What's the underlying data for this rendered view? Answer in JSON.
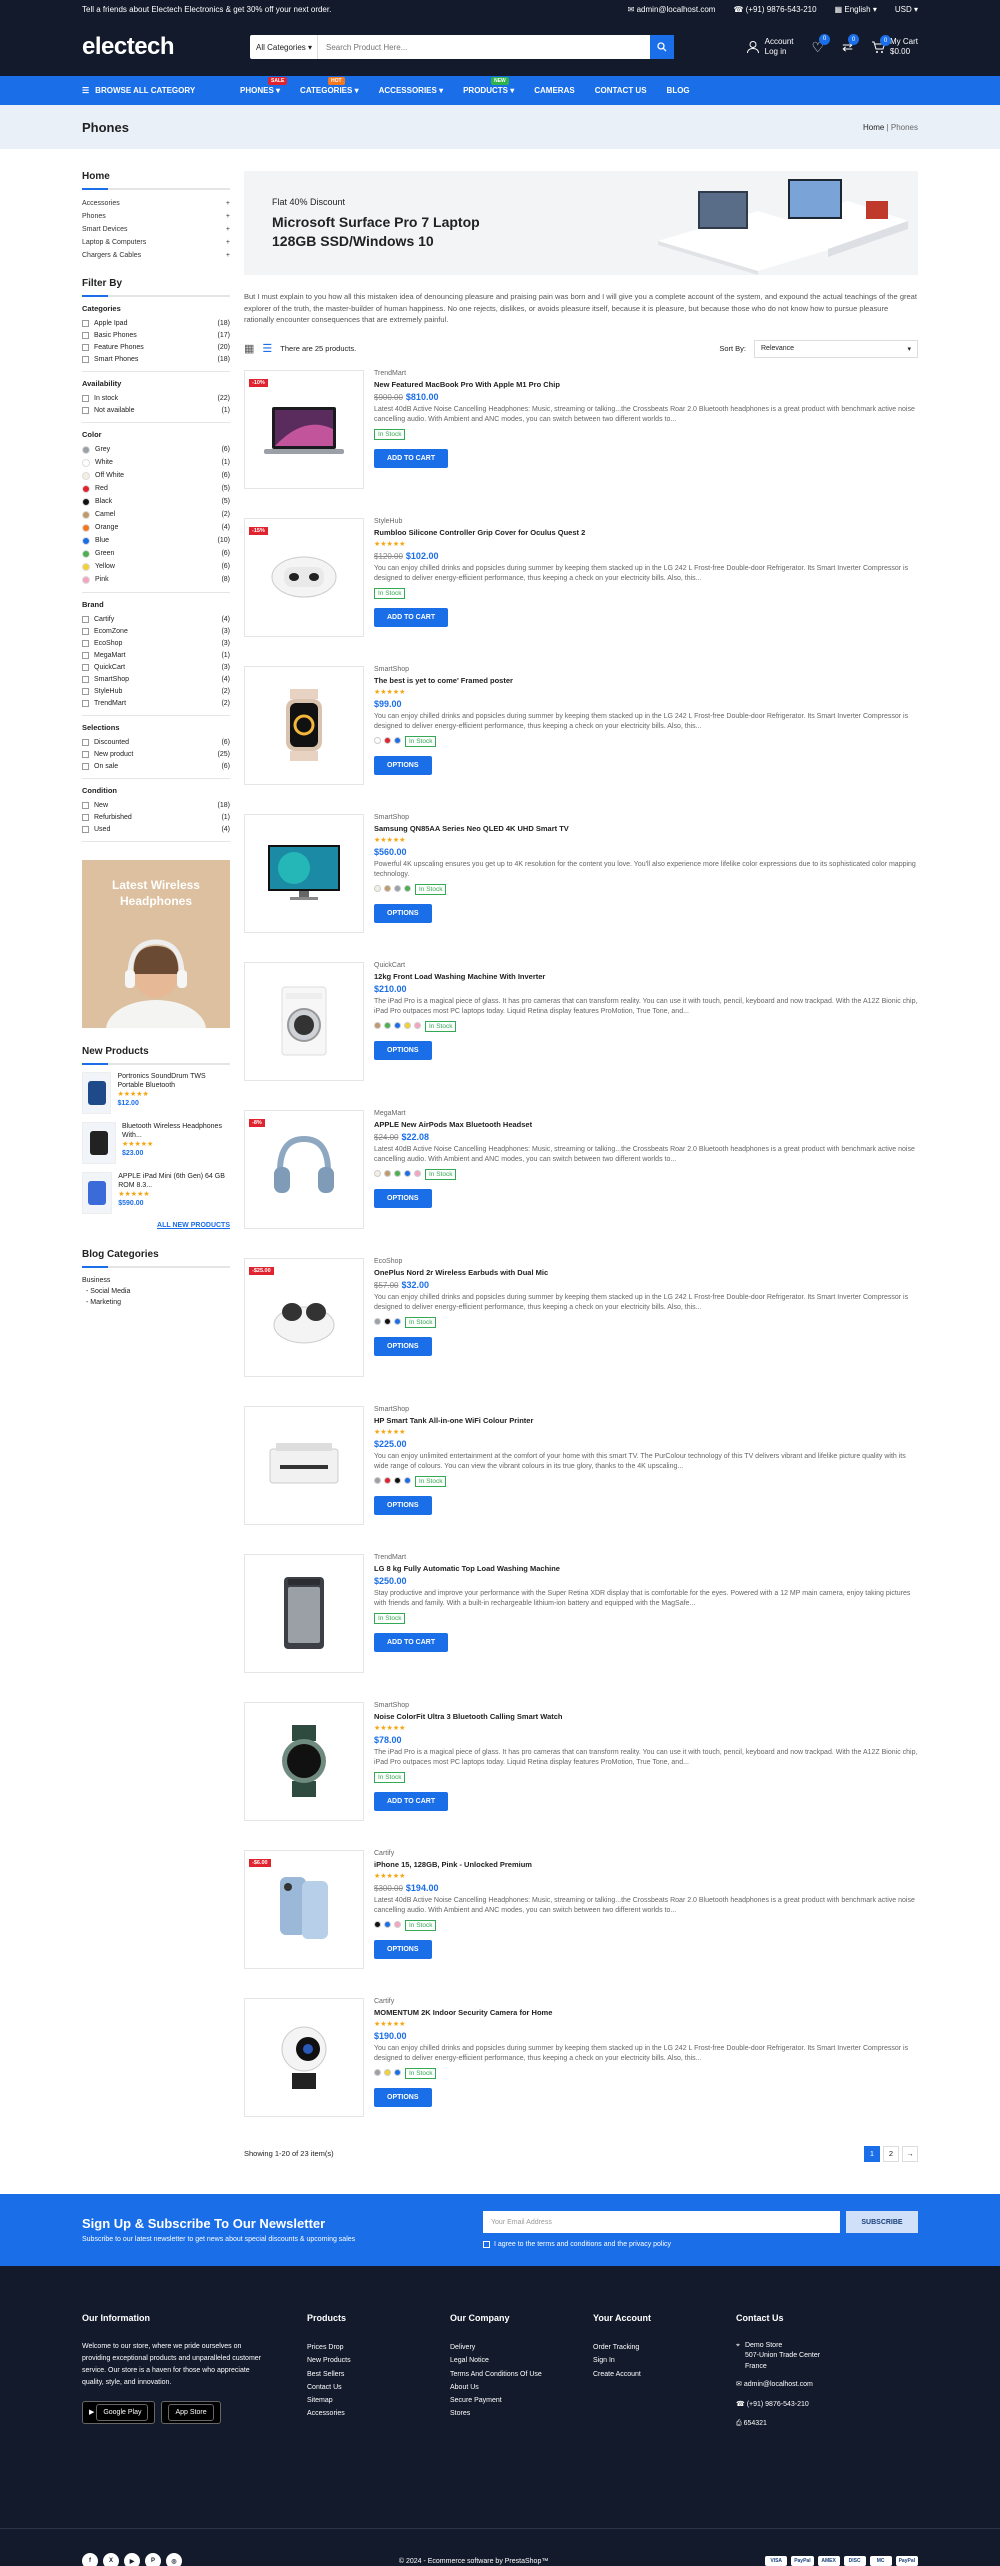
{
  "topbar": {
    "promo": "Tell a friends about Electech Electronics & get 30% off your next order.",
    "email": "admin@localhost.com",
    "phone": "(+91) 9876-543-210",
    "language": "English",
    "currency": "USD"
  },
  "header": {
    "logo": "electech",
    "search_category": "All Categories",
    "search_placeholder": "Search Product Here...",
    "account_label": "Account",
    "login_label": "Log in",
    "wishlist_count": "0",
    "compare_count": "0",
    "cart_count": "0",
    "cart_label": "My Cart",
    "cart_total": "$0.00"
  },
  "nav": {
    "browse": "BROWSE ALL CATEGORY",
    "items": [
      {
        "label": "PHONES",
        "tag": "SALE",
        "tag_color": "#e0232e"
      },
      {
        "label": "CATEGORIES",
        "tag": "HOT",
        "tag_color": "#f5781f"
      },
      {
        "label": "ACCESSORIES",
        "tag": "",
        "tag_color": ""
      },
      {
        "label": "PRODUCTS",
        "tag": "NEW",
        "tag_color": "#2db34a"
      },
      {
        "label": "CAMERAS",
        "tag": "",
        "tag_color": ""
      },
      {
        "label": "CONTACT US",
        "tag": "",
        "tag_color": ""
      },
      {
        "label": "BLOG",
        "tag": "",
        "tag_color": ""
      }
    ]
  },
  "page": {
    "title": "Phones",
    "crumb_home": "Home",
    "crumb_current": "Phones"
  },
  "sidebar": {
    "home": "Home",
    "categories": [
      "Accessories",
      "Phones",
      "Smart Devices",
      "Laptop & Computers",
      "Chargers & Cables"
    ],
    "filter_title": "Filter By",
    "groups": [
      {
        "title": "Categories",
        "rows": [
          {
            "label": "Apple Ipad",
            "count": "(18)"
          },
          {
            "label": "Basic Phones",
            "count": "(17)"
          },
          {
            "label": "Feature Phones",
            "count": "(20)"
          },
          {
            "label": "Smart Phones",
            "count": "(18)"
          }
        ]
      },
      {
        "title": "Availability",
        "rows": [
          {
            "label": "In stock",
            "count": "(22)"
          },
          {
            "label": "Not available",
            "count": "(1)"
          }
        ]
      },
      {
        "title": "Color",
        "rows": [
          {
            "label": "Grey",
            "count": "(6)",
            "color": "#9aa0a6"
          },
          {
            "label": "White",
            "count": "(1)",
            "color": "#ffffff"
          },
          {
            "label": "Off White",
            "count": "(6)",
            "color": "#f4efe3"
          },
          {
            "label": "Red",
            "count": "(5)",
            "color": "#e0232e"
          },
          {
            "label": "Black",
            "count": "(5)",
            "color": "#111111"
          },
          {
            "label": "Camel",
            "count": "(2)",
            "color": "#c19a6b"
          },
          {
            "label": "Orange",
            "count": "(4)",
            "color": "#f5781f"
          },
          {
            "label": "Blue",
            "count": "(10)",
            "color": "#1a6ee8"
          },
          {
            "label": "Green",
            "count": "(6)",
            "color": "#4caf50"
          },
          {
            "label": "Yellow",
            "count": "(6)",
            "color": "#f2d233"
          },
          {
            "label": "Pink",
            "count": "(8)",
            "color": "#f4a6c0"
          }
        ]
      },
      {
        "title": "Brand",
        "rows": [
          {
            "label": "Cartify",
            "count": "(4)"
          },
          {
            "label": "EcomZone",
            "count": "(3)"
          },
          {
            "label": "EcoShop",
            "count": "(3)"
          },
          {
            "label": "MegaMart",
            "count": "(1)"
          },
          {
            "label": "QuickCart",
            "count": "(3)"
          },
          {
            "label": "SmartShop",
            "count": "(4)"
          },
          {
            "label": "StyleHub",
            "count": "(2)"
          },
          {
            "label": "TrendMart",
            "count": "(2)"
          }
        ]
      },
      {
        "title": "Selections",
        "rows": [
          {
            "label": "Discounted",
            "count": "(6)"
          },
          {
            "label": "New product",
            "count": "(25)"
          },
          {
            "label": "On sale",
            "count": "(6)"
          }
        ]
      },
      {
        "title": "Condition",
        "rows": [
          {
            "label": "New",
            "count": "(18)"
          },
          {
            "label": "Refurbished",
            "count": "(1)"
          },
          {
            "label": "Used",
            "count": "(4)"
          }
        ]
      }
    ],
    "banner": "Latest Wireless Headphones",
    "new_title": "New Products",
    "new_products": [
      {
        "name": "Portronics SoundDrum TWS Portable Bluetooth",
        "price": "$12.00"
      },
      {
        "name": "Bluetooth Wireless Headphones With...",
        "price": "$23.00"
      },
      {
        "name": "APPLE iPad Mini (6th Gen) 64 GB ROM 8.3...",
        "price": "$590.00"
      }
    ],
    "all_new": "ALL NEW PRODUCTS",
    "blog_title": "Blog Categories",
    "blog": [
      "Business",
      "- Social Media",
      "- Marketing"
    ]
  },
  "hero": {
    "sub": "Flat 40% Discount",
    "title1": "Microsoft Surface Pro 7 Laptop",
    "title2": "128GB SSD/Windows 10"
  },
  "description": "But I must explain to you how all this mistaken idea of denouncing pleasure and praising pain was born and I will give you a complete account of the system, and expound the actual teachings of the great explorer of the truth, the master-builder of human happiness. No one rejects, dislikes, or avoids pleasure itself, because it is pleasure, but because those who do not know how to pursue pleasure rationally encounter consequences that are extremely painful.",
  "toolbar": {
    "count": "There are 25 products.",
    "sort_label": "Sort By:",
    "sort_value": "Relevance"
  },
  "products": [
    {
      "brand": "TrendMart",
      "name": "New Featured MacBook Pro With Apple M1 Pro Chip",
      "old": "$900.00",
      "price": "$810.00",
      "disc": "-10%",
      "desc": "Latest 40dB Active Noise Cancelling Headphones: Music, streaming or talking...the Crossbeats Roar 2.0 Bluetooth headphones is a great product with benchmark active noise cancelling audio. With Ambient and ANC modes, you can switch between two different worlds to...",
      "btn": "ADD TO CART",
      "stock": "In Stock",
      "rated": false,
      "swatches": []
    },
    {
      "brand": "StyleHub",
      "name": "Rumbloo Silicone Controller Grip Cover for Oculus Quest 2",
      "old": "$120.00",
      "price": "$102.00",
      "disc": "-15%",
      "desc": "You can enjoy chilled drinks and popsicles during summer by keeping them stacked up in the LG 242 L Frost-free Double-door Refrigerator. Its Smart Inverter Compressor is designed to deliver energy-efficient performance, thus keeping a check on your electricity bills. Also, this...",
      "btn": "ADD TO CART",
      "stock": "In Stock",
      "rated": true,
      "swatches": []
    },
    {
      "brand": "SmartShop",
      "name": "The best is yet to come' Framed poster",
      "old": "",
      "price": "$99.00",
      "disc": "",
      "desc": "You can enjoy chilled drinks and popsicles during summer by keeping them stacked up in the LG 242 L Frost-free Double-door Refrigerator. Its Smart Inverter Compressor is designed to deliver energy-efficient performance, thus keeping a check on your electricity bills. Also, this...",
      "btn": "OPTIONS",
      "stock": "In Stock",
      "rated": true,
      "swatches": [
        "#ffffff",
        "#e0232e",
        "#1a6ee8"
      ]
    },
    {
      "brand": "SmartShop",
      "name": "Samsung QN85AA Series Neo QLED 4K UHD Smart TV",
      "old": "",
      "price": "$560.00",
      "disc": "",
      "desc": "Powerful 4K upscaling ensures you get up to 4K resolution for the content you love. You'll also experience more lifelike color expressions due to its sophisticated color mapping technology.",
      "btn": "OPTIONS",
      "stock": "In Stock",
      "rated": true,
      "swatches": [
        "#f4efe3",
        "#c19a6b",
        "#9aa0a6",
        "#4caf50"
      ]
    },
    {
      "brand": "QuickCart",
      "name": "12kg Front Load Washing Machine With Inverter",
      "old": "",
      "price": "$210.00",
      "disc": "",
      "desc": "The iPad Pro is a magical piece of glass. It has pro cameras that can transform reality. You can use it with touch, pencil, keyboard and now trackpad. With the A12Z Bionic chip, iPad Pro outpaces most PC laptops today. Liquid Retina display features ProMotion, True Tone, and...",
      "btn": "OPTIONS",
      "stock": "In Stock",
      "rated": false,
      "swatches": [
        "#c19a6b",
        "#4caf50",
        "#1a6ee8",
        "#f2d233",
        "#f4a6c0"
      ]
    },
    {
      "brand": "MegaMart",
      "name": "APPLE New AirPods Max Bluetooth Headset",
      "old": "$24.00",
      "price": "$22.08",
      "disc": "-8%",
      "desc": "Latest 40dB Active Noise Cancelling Headphones: Music, streaming or talking...the Crossbeats Roar 2.0 Bluetooth headphones is a great product with benchmark active noise cancelling audio. With Ambient and ANC modes, you can switch between two different worlds to...",
      "btn": "OPTIONS",
      "stock": "In Stock",
      "rated": false,
      "swatches": [
        "#f4efe3",
        "#c19a6b",
        "#4caf50",
        "#1a6ee8",
        "#f4a6c0"
      ]
    },
    {
      "brand": "EcoShop",
      "name": "OnePlus Nord 2r Wireless Earbuds with Dual Mic",
      "old": "$57.00",
      "price": "$32.00",
      "disc": "-$25.00",
      "desc": "You can enjoy chilled drinks and popsicles during summer by keeping them stacked up in the LG 242 L Frost-free Double-door Refrigerator. Its Smart Inverter Compressor is designed to deliver energy-efficient performance, thus keeping a check on your electricity bills. Also, this...",
      "btn": "OPTIONS",
      "stock": "In Stock",
      "rated": false,
      "swatches": [
        "#9aa0a6",
        "#111111",
        "#1a6ee8"
      ]
    },
    {
      "brand": "SmartShop",
      "name": "HP Smart Tank All-in-one WiFi Colour Printer",
      "old": "",
      "price": "$225.00",
      "disc": "",
      "desc": "You can enjoy unlimited entertainment at the comfort of your home with this smart TV. The PurColour technology of this TV delivers vibrant and lifelike picture quality with its wide range of colours. You can view the vibrant colours in its true glory, thanks to the 4K upscaling...",
      "btn": "OPTIONS",
      "stock": "In Stock",
      "rated": true,
      "swatches": [
        "#9aa0a6",
        "#e0232e",
        "#111111",
        "#1a6ee8"
      ]
    },
    {
      "brand": "TrendMart",
      "name": "LG 8 kg Fully Automatic Top Load Washing Machine",
      "old": "",
      "price": "$250.00",
      "disc": "",
      "desc": "Stay productive and improve your performance with the Super Retina XDR display that is comfortable for the eyes. Powered with a 12 MP main camera, enjoy taking pictures with friends and family. With a built-in rechargeable lithium-ion battery and equipped with the MagSafe...",
      "btn": "ADD TO CART",
      "stock": "In Stock",
      "rated": false,
      "swatches": []
    },
    {
      "brand": "SmartShop",
      "name": "Noise ColorFit Ultra 3 Bluetooth Calling Smart Watch",
      "old": "",
      "price": "$78.00",
      "disc": "",
      "desc": "The iPad Pro is a magical piece of glass. It has pro cameras that can transform reality. You can use it with touch, pencil, keyboard and now trackpad. With the A12Z Bionic chip, iPad Pro outpaces most PC laptops today. Liquid Retina display features ProMotion, True Tone, and...",
      "btn": "ADD TO CART",
      "stock": "In Stock",
      "rated": true,
      "swatches": []
    },
    {
      "brand": "Cartify",
      "name": "iPhone 15, 128GB, Pink - Unlocked Premium",
      "old": "$300.00",
      "price": "$194.00",
      "disc": "-$6.00",
      "desc": "Latest 40dB Active Noise Cancelling Headphones: Music, streaming or talking...the Crossbeats Roar 2.0 Bluetooth headphones is a great product with benchmark active noise cancelling audio. With Ambient and ANC modes, you can switch between two different worlds to...",
      "btn": "OPTIONS",
      "stock": "In Stock",
      "rated": true,
      "swatches": [
        "#111111",
        "#1a6ee8",
        "#f4a6c0"
      ]
    },
    {
      "brand": "Cartify",
      "name": "MOMENTUM 2K Indoor Security Camera for Home",
      "old": "",
      "price": "$190.00",
      "disc": "",
      "desc": "You can enjoy chilled drinks and popsicles during summer by keeping them stacked up in the LG 242 L Frost-free Double-door Refrigerator. Its Smart Inverter Compressor is designed to deliver energy-efficient performance, thus keeping a check on your electricity bills. Also, this...",
      "btn": "OPTIONS",
      "stock": "In Stock",
      "rated": true,
      "swatches": [
        "#9aa0a6",
        "#f2d233",
        "#1a6ee8"
      ]
    }
  ],
  "pagination": {
    "showing": "Showing 1-20 of 23 item(s)",
    "p1": "1",
    "p2": "2",
    "next": "→"
  },
  "newsletter": {
    "title": "Sign Up & Subscribe To Our Newsletter",
    "sub": "Subscribe to our latest newsletter to get news about special discounts & upcoming sales",
    "placeholder": "Your Email Address",
    "btn": "SUBSCRIBE",
    "agree": "I agree to the terms and conditions and the privacy policy"
  },
  "footer": {
    "info_title": "Our Information",
    "info_text": "Welcome to our store, where we pride ourselves on providing exceptional products and unparalleled customer service. Our store is a haven for those who appreciate quality, style, and innovation.",
    "gplay": "Google Play",
    "appstore": "App Store",
    "cols": [
      {
        "title": "Products",
        "links": [
          "Prices Drop",
          "New Products",
          "Best Sellers",
          "Contact Us",
          "Sitemap",
          "Accessories"
        ]
      },
      {
        "title": "Our Company",
        "links": [
          "Delivery",
          "Legal Notice",
          "Terms And Conditions Of Use",
          "About Us",
          "Secure Payment",
          "Stores"
        ]
      },
      {
        "title": "Your Account",
        "links": [
          "Order Tracking",
          "Sign In",
          "Create Account"
        ]
      }
    ],
    "contact_title": "Contact Us",
    "store": "Demo Store",
    "addr1": "507-Union Trade Center",
    "addr2": "France",
    "email": "admin@localhost.com",
    "phone": "(+91) 9876-543-210",
    "fax": "654321",
    "copyright": "© 2024 - Ecommerce software by PrestaShop™",
    "social": [
      "f",
      "X",
      "▶",
      "P",
      "◎"
    ],
    "payments": [
      "VISA",
      "PayPal",
      "AMEX",
      "DISC",
      "MC",
      "PayPal"
    ]
  }
}
